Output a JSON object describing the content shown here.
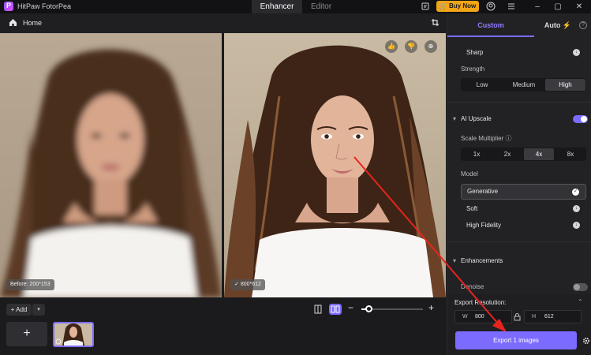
{
  "app": {
    "title": "HitPaw FotorPea"
  },
  "modes": {
    "enhancer": "Enhancer",
    "editor": "Editor"
  },
  "titlebar": {
    "buy_now": "Buy Now"
  },
  "toolbar": {
    "home": "Home"
  },
  "preview": {
    "before_badge": "Before: 200*153",
    "after_badge": "800*612"
  },
  "bottom": {
    "add_label": "Add",
    "add_tile": "+"
  },
  "panel": {
    "tab_custom": "Custom",
    "tab_auto": "Auto",
    "sharp": "Sharp",
    "strength_label": "Strength",
    "strength_options": [
      "Low",
      "Medium",
      "High"
    ],
    "strength_selected": "High",
    "ai_upscale": "AI Upscale",
    "scale_label": "Scale Multiplier",
    "scale_options": [
      "1x",
      "2x",
      "4x",
      "8x"
    ],
    "scale_selected": "4x",
    "model_label": "Model",
    "models": [
      "Generative",
      "Soft",
      "High Fidelity"
    ],
    "model_selected": "Generative",
    "enhancements": "Enhancements",
    "denoise": "Denoise",
    "export_resolution": "Export Resolution:",
    "width_key": "W",
    "width_value": "800",
    "height_key": "H",
    "height_value": "612",
    "export_button": "Export 1 images"
  },
  "colors": {
    "accent": "#7b6cff",
    "buy_now": "#f2a516",
    "arrow": "#e8241f"
  }
}
